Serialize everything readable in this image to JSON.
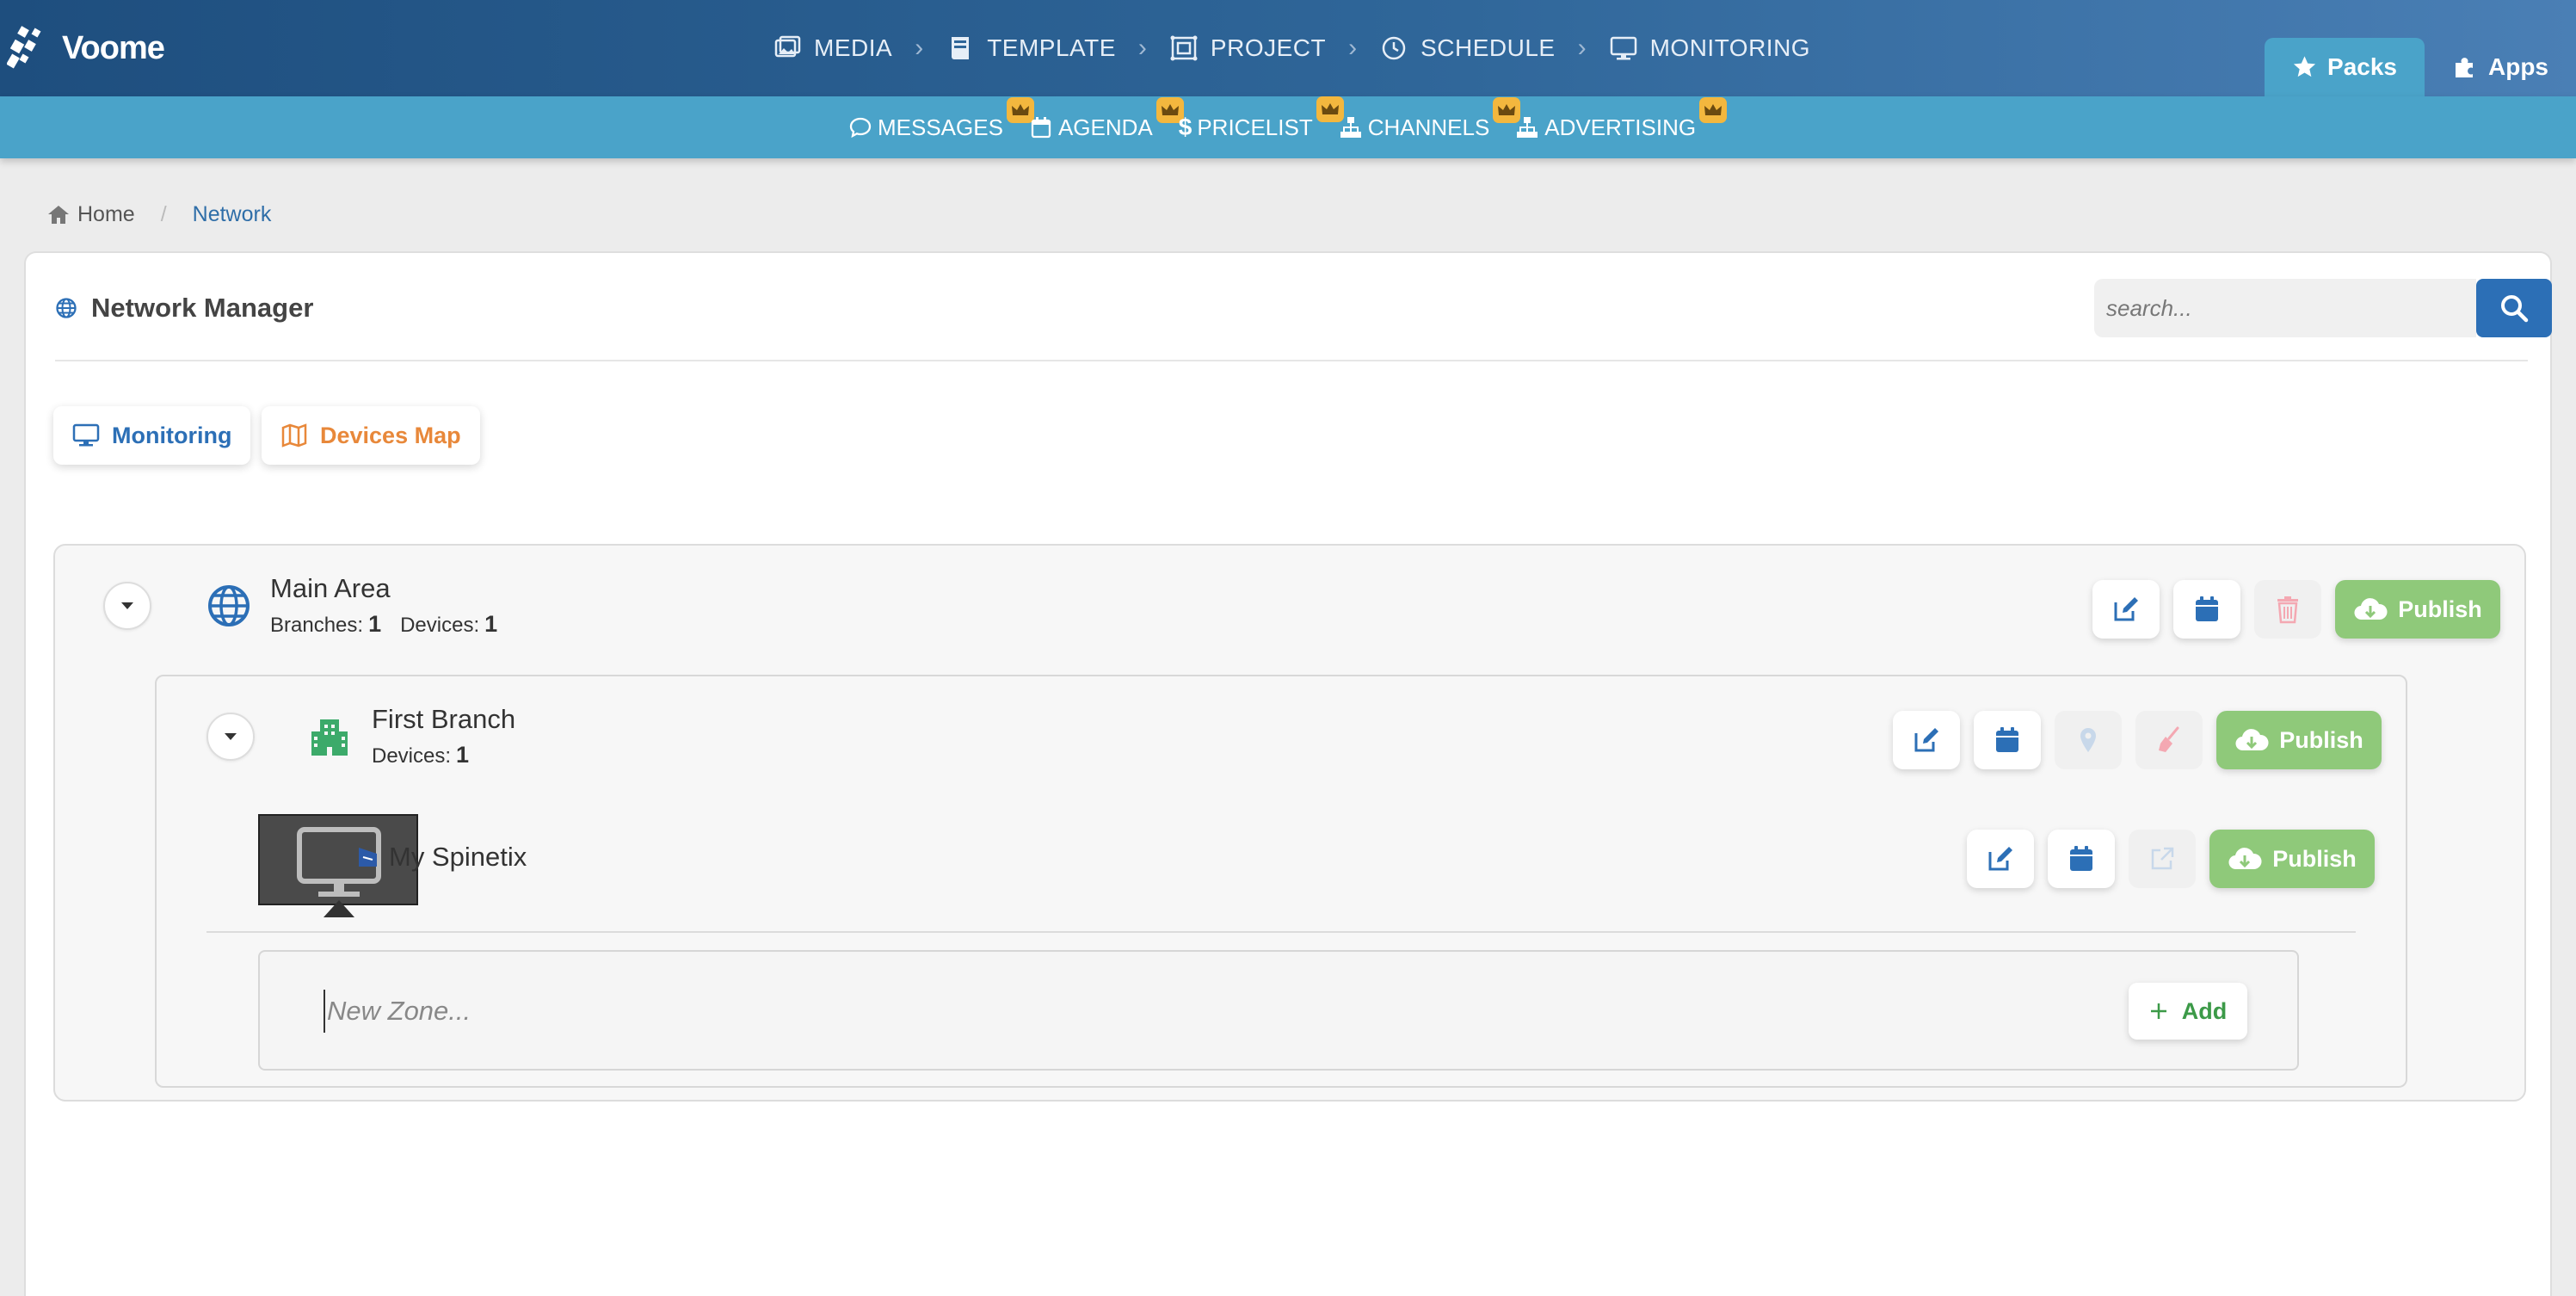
{
  "app": {
    "logo_text": "Voome"
  },
  "main_nav": [
    {
      "label": "MEDIA",
      "icon": "images-icon"
    },
    {
      "label": "TEMPLATE",
      "icon": "book-icon"
    },
    {
      "label": "PROJECT",
      "icon": "project-icon"
    },
    {
      "label": "SCHEDULE",
      "icon": "clock-icon"
    },
    {
      "label": "MONITORING",
      "icon": "desktop-icon"
    }
  ],
  "top_tabs": [
    {
      "label": "Packs",
      "icon": "star-icon",
      "active": true
    },
    {
      "label": "Apps",
      "icon": "puzzle-icon",
      "active": false
    }
  ],
  "sub_nav": [
    {
      "label": "MESSAGES",
      "icon": "comment-icon",
      "premium": true
    },
    {
      "label": "AGENDA",
      "icon": "calendar-icon",
      "premium": true
    },
    {
      "label": "PRICELIST",
      "icon": "dollar-icon",
      "premium": true
    },
    {
      "label": "CHANNELS",
      "icon": "sitemap-icon",
      "premium": true
    },
    {
      "label": "ADVERTISING",
      "icon": "sitemap-icon",
      "premium": true
    }
  ],
  "breadcrumb": {
    "home": "Home",
    "current": "Network"
  },
  "panel": {
    "title": "Network Manager",
    "search_placeholder": "search...",
    "monitoring_label": "Monitoring",
    "devices_map_label": "Devices Map"
  },
  "area": {
    "name": "Main Area",
    "branches_label": "Branches:",
    "branches_count": "1",
    "devices_label": "Devices:",
    "devices_count": "1",
    "publish_label": "Publish"
  },
  "branch": {
    "name": "First Branch",
    "devices_label": "Devices:",
    "devices_count": "1",
    "publish_label": "Publish"
  },
  "device": {
    "name": "My Spinetix",
    "publish_label": "Publish"
  },
  "zone": {
    "placeholder": "New Zone...",
    "add_label": "Add"
  },
  "colors": {
    "primary": "#2c6fb6",
    "topbar": "#2f6699",
    "subbar": "#4aa3c9",
    "publish": "#8fc97a",
    "devices_map": "#e8883a",
    "crown": "#f3b73e",
    "branch_icon": "#3caa6a",
    "delete": "#f08a98"
  }
}
